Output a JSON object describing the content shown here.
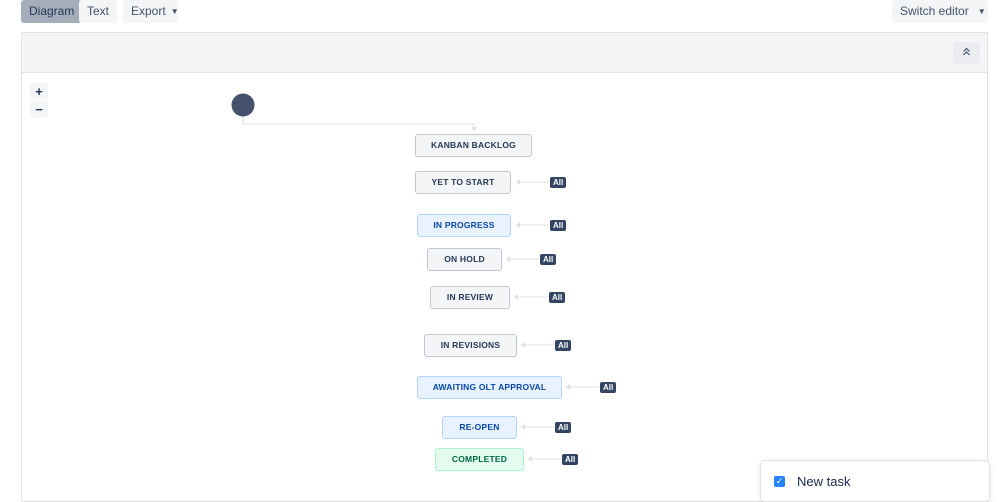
{
  "toolbar": {
    "diagram": "Diagram",
    "text": "Text",
    "export": "Export",
    "switch_editor": "Switch editor"
  },
  "zoom": {
    "in": "+",
    "out": "−"
  },
  "statuses": {
    "kanban_backlog": "KANBAN BACKLOG",
    "yet_to_start": "YET TO START",
    "in_progress": "IN PROGRESS",
    "on_hold": "ON HOLD",
    "in_review": "IN REVIEW",
    "in_revisions": "IN REVISIONS",
    "awaiting_olt_approval": "AWAITING OLT APPROVAL",
    "re_open": "RE-OPEN",
    "completed": "COMPLETED"
  },
  "transition_label": "All",
  "task_card": {
    "label": "New task"
  },
  "colors": {
    "start_node": "#44526e",
    "connector": "#dfe1e6",
    "badge": "#344563",
    "status_grey": "#f4f5f7",
    "status_blue": "#e9f2ff",
    "status_green": "#e3fcef"
  },
  "icons": {
    "export_menu": "chevron-down-icon",
    "switch_menu": "chevron-down-icon",
    "collapse": "double-chevron-up-icon",
    "task_checkbox": "checkbox-checked-icon"
  }
}
